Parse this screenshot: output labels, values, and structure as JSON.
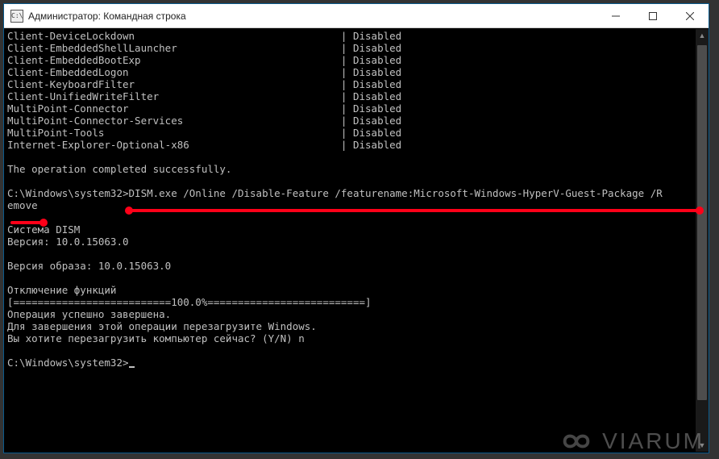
{
  "window": {
    "title": "Администратор: Командная строка"
  },
  "features": [
    {
      "name": "Client-DeviceLockdown",
      "state": "Disabled"
    },
    {
      "name": "Client-EmbeddedShellLauncher",
      "state": "Disabled"
    },
    {
      "name": "Client-EmbeddedBootExp",
      "state": "Disabled"
    },
    {
      "name": "Client-EmbeddedLogon",
      "state": "Disabled"
    },
    {
      "name": "Client-KeyboardFilter",
      "state": "Disabled"
    },
    {
      "name": "Client-UnifiedWriteFilter",
      "state": "Disabled"
    },
    {
      "name": "MultiPoint-Connector",
      "state": "Disabled"
    },
    {
      "name": "MultiPoint-Connector-Services",
      "state": "Disabled"
    },
    {
      "name": "MultiPoint-Tools",
      "state": "Disabled"
    },
    {
      "name": "Internet-Explorer-Optional-x86",
      "state": "Disabled"
    }
  ],
  "msg": {
    "op_complete": "The operation completed successfully.",
    "prompt1": "C:\\Windows\\system32>",
    "cmd_line1": "DISM.exe /Online /Disable-Feature /featurename:Microsoft-Windows-HyperV-Guest-Package /R",
    "cmd_line2": "emove",
    "dism_header": "Cистема DISM",
    "dism_version": "Версия: 10.0.15063.0",
    "image_version": "Версия образа: 10.0.15063.0",
    "disabling": "Отключение функций",
    "progress": "[==========================100.0%==========================]",
    "op_success": "Операция успешно завершена.",
    "restart_needed": "Для завершения этой операции перезагрузите Windows.",
    "restart_prompt": "Вы хотите перезагрузить компьютер сейчас? (Y/N) n",
    "prompt2": "C:\\Windows\\system32>"
  },
  "watermark": {
    "text": "VIARUM"
  }
}
